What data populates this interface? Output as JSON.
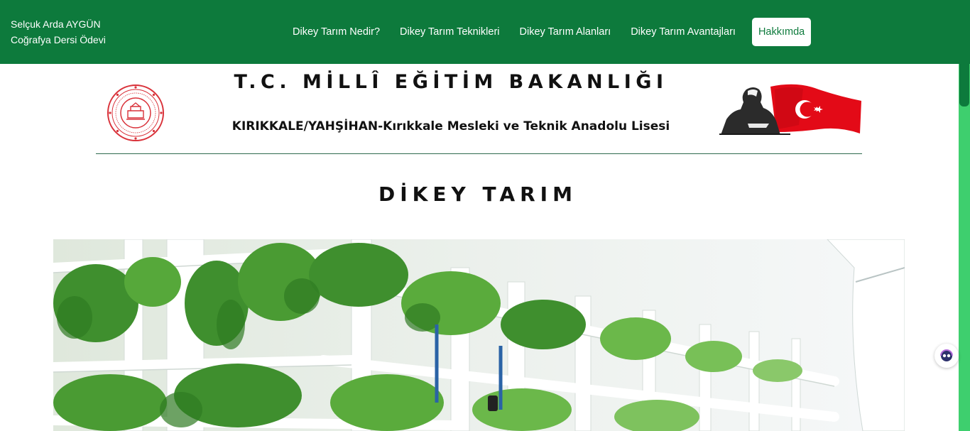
{
  "brand": {
    "line1": "Selçuk Arda AYGÜN",
    "line2": "Coğrafya Dersi Ödevi"
  },
  "nav": {
    "items": [
      {
        "label": "Dikey Tarım Nedir?"
      },
      {
        "label": "Dikey Tarım Teknikleri"
      },
      {
        "label": "Dikey Tarım Alanları"
      },
      {
        "label": "Dikey Tarım Avantajları"
      },
      {
        "label": "Hakkımda"
      }
    ]
  },
  "header": {
    "title": "T.C. MİLLÎ EĞİTİM BAKANLIĞI",
    "subtitle": "KIRIKKALE/YAHŞİHAN-Kırıkkale Mesleki ve Teknik Anadolu Lisesi"
  },
  "page": {
    "title": "DİKEY TARIM"
  },
  "colors": {
    "primary": "#0d7a3c",
    "scrollbar": "#3ecf6e",
    "seal": "#d9323a",
    "flag": "#e30a17"
  },
  "icons": {
    "seal": "meb-seal-icon",
    "flag": "ataturk-flag-image",
    "assistant": "assistant-icon"
  }
}
